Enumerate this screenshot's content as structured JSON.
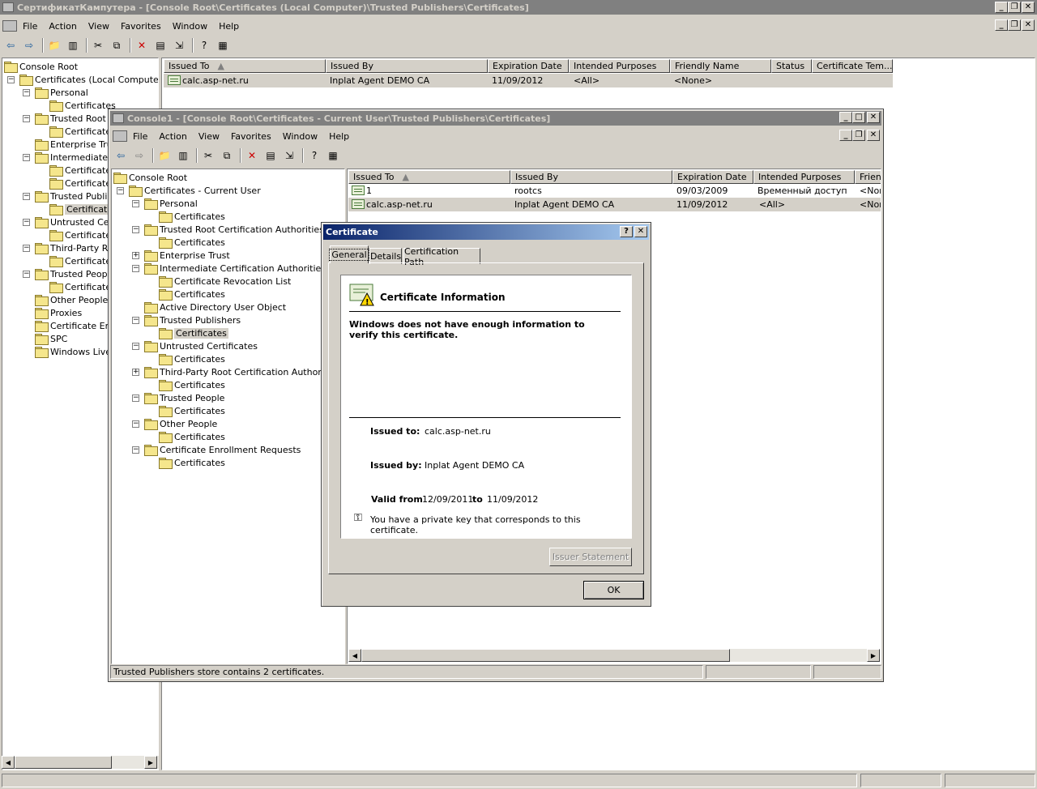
{
  "outer": {
    "title": "СертификатКампутера - [Console Root\\Certificates (Local Computer)\\Trusted Publishers\\Certificates]",
    "menu": [
      "File",
      "Action",
      "View",
      "Favorites",
      "Window",
      "Help"
    ],
    "tree": [
      {
        "label": "Console Root"
      },
      {
        "label": "Certificates (Local Computer)"
      },
      {
        "label": "Personal"
      },
      {
        "label": "Certificates"
      },
      {
        "label": "Trusted Root C"
      },
      {
        "label": "Certificate"
      },
      {
        "label": "Enterprise Tru"
      },
      {
        "label": "Intermediate C"
      },
      {
        "label": "Certificate"
      },
      {
        "label": "Certificate"
      },
      {
        "label": "Trusted Publisl"
      },
      {
        "label": "Certificate"
      },
      {
        "label": "Untrusted Cer"
      },
      {
        "label": "Certificate"
      },
      {
        "label": "Third-Party Ro"
      },
      {
        "label": "Certificate"
      },
      {
        "label": "Trusted People"
      },
      {
        "label": "Certificate"
      },
      {
        "label": "Other People"
      },
      {
        "label": "Proxies"
      },
      {
        "label": "Certificate Enr"
      },
      {
        "label": "SPC"
      },
      {
        "label": "Windows Live"
      }
    ],
    "columns": [
      "Issued To",
      "Issued By",
      "Expiration Date",
      "Intended Purposes",
      "Friendly Name",
      "Status",
      "Certificate Tem..."
    ],
    "rows": [
      {
        "issued_to": "calc.asp-net.ru",
        "issued_by": "Inplat Agent DEMO CA",
        "expiration": "11/09/2012",
        "purposes": "<All>",
        "friendly": "<None>"
      }
    ]
  },
  "inner": {
    "title": "Console1 - [Console Root\\Certificates - Current User\\Trusted Publishers\\Certificates]",
    "menu": [
      "File",
      "Action",
      "View",
      "Favorites",
      "Window",
      "Help"
    ],
    "tree": [
      {
        "label": "Console Root"
      },
      {
        "label": "Certificates - Current User"
      },
      {
        "label": "Personal"
      },
      {
        "label": "Certificates"
      },
      {
        "label": "Trusted Root Certification Authorities"
      },
      {
        "label": "Certificates"
      },
      {
        "label": "Enterprise Trust"
      },
      {
        "label": "Intermediate Certification Authorities"
      },
      {
        "label": "Certificate Revocation List"
      },
      {
        "label": "Certificates"
      },
      {
        "label": "Active Directory User Object"
      },
      {
        "label": "Trusted Publishers"
      },
      {
        "label": "Certificates"
      },
      {
        "label": "Untrusted Certificates"
      },
      {
        "label": "Certificates"
      },
      {
        "label": "Third-Party Root Certification Authorities"
      },
      {
        "label": "Certificates"
      },
      {
        "label": "Trusted People"
      },
      {
        "label": "Certificates"
      },
      {
        "label": "Other People"
      },
      {
        "label": "Certificates"
      },
      {
        "label": "Certificate Enrollment Requests"
      },
      {
        "label": "Certificates"
      }
    ],
    "columns": [
      "Issued To",
      "Issued By",
      "Expiration Date",
      "Intended Purposes",
      "Frien"
    ],
    "rows": [
      {
        "issued_to": "1",
        "issued_by": "rootcs",
        "expiration": "09/03/2009",
        "purposes": "Временный доступ ...",
        "friendly": "<Non"
      },
      {
        "issued_to": "calc.asp-net.ru",
        "issued_by": "Inplat Agent DEMO CA",
        "expiration": "11/09/2012",
        "purposes": "<All>",
        "friendly": "<Non"
      }
    ],
    "status": "Trusted Publishers store contains 2 certificates."
  },
  "dialog": {
    "title": "Certificate",
    "help_glyph": "?",
    "close_glyph": "✕",
    "tabs": [
      "General",
      "Details",
      "Certification Path"
    ],
    "info_heading": "Certificate Information",
    "warning": "Windows does not have enough information to verify this certificate.",
    "issued_to_label": "Issued to:",
    "issued_to": "calc.asp-net.ru",
    "issued_by_label": "Issued by:",
    "issued_by": "Inplat Agent DEMO CA",
    "valid_from_label": "Valid from",
    "valid_from": "12/09/2011",
    "valid_to_label": "to",
    "valid_to": "11/09/2012",
    "private_key_note": "You have a private key that corresponds to this certificate.",
    "issuer_statement_label": "Issuer Statement",
    "ok_label": "OK"
  }
}
